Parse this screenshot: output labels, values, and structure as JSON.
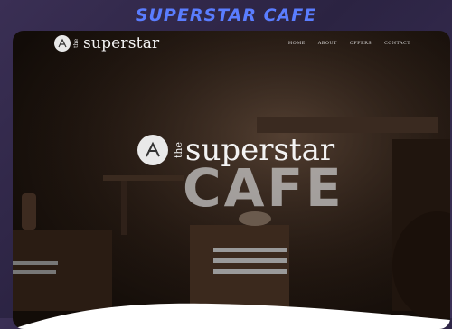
{
  "page_heading": "SUPERSTAR CAFE",
  "nav": {
    "brand_the": "the",
    "brand_name": "superstar",
    "items": [
      "HOME",
      "ABOUT",
      "OFFERS",
      "CONTACT"
    ]
  },
  "hero": {
    "logo_the": "the",
    "logo_name": "superstar",
    "cafe": "CAFE"
  },
  "colors": {
    "heading": "#5a7dff",
    "background": "#2b2342",
    "hero_text": "#f3f3f3"
  }
}
